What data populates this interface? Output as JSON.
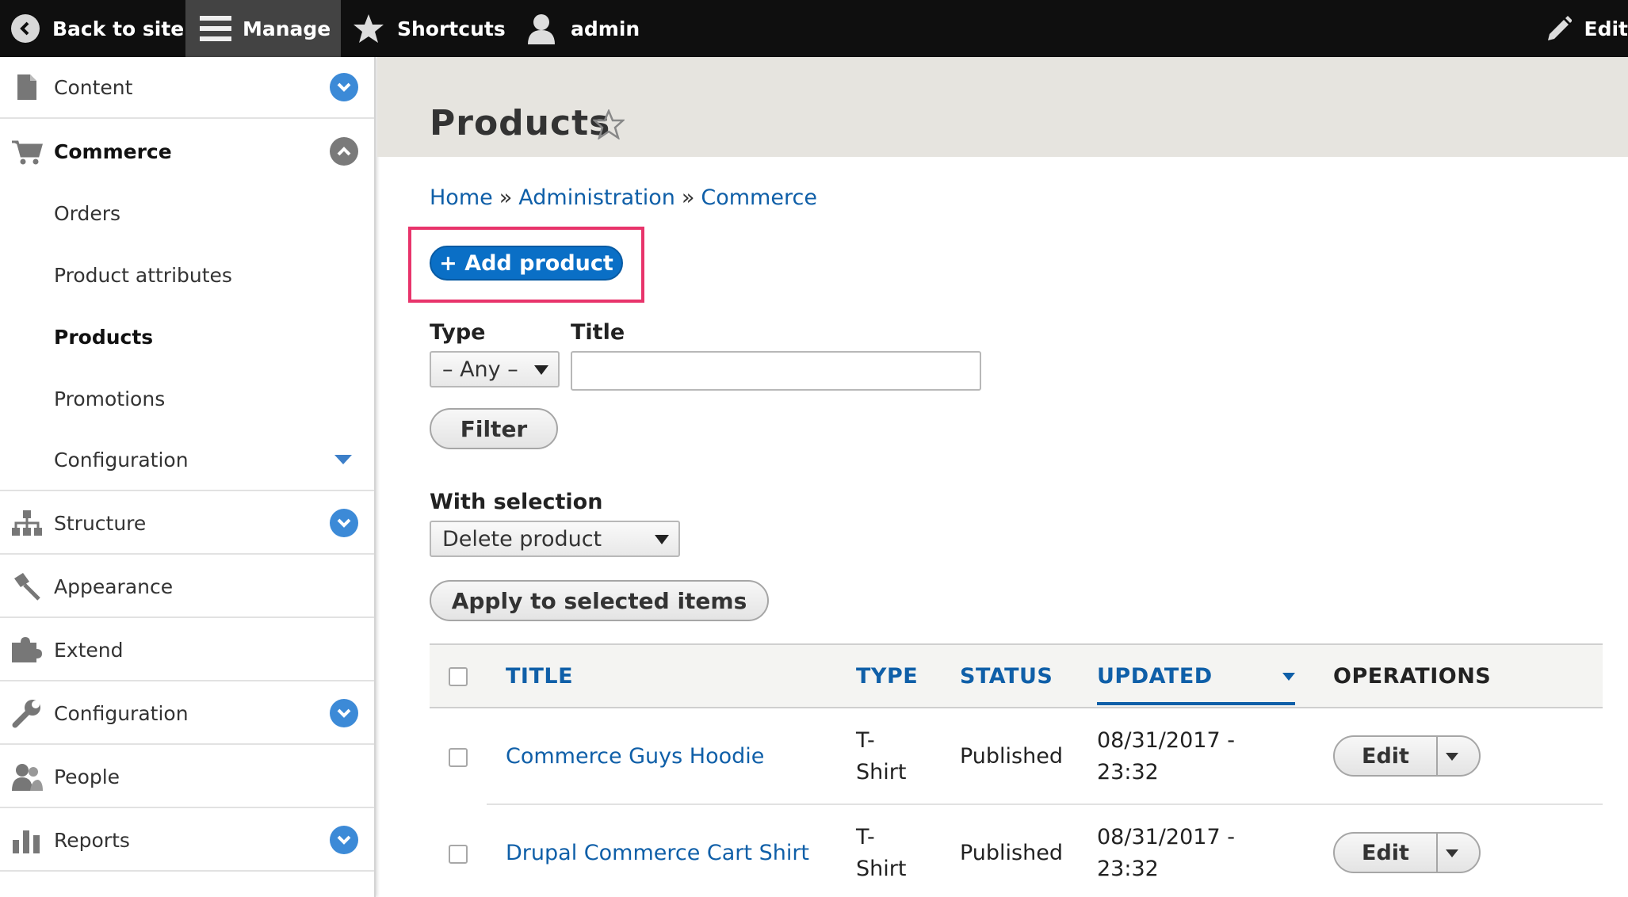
{
  "toolbar": {
    "back_label": "Back to site",
    "manage_label": "Manage",
    "shortcuts_label": "Shortcuts",
    "user_label": "admin",
    "edit_label": "Edit"
  },
  "sidebar": {
    "items": [
      {
        "label": "Content",
        "icon": "file-icon"
      },
      {
        "label": "Commerce",
        "icon": "cart-icon"
      },
      {
        "label": "Structure",
        "icon": "sitemap-icon"
      },
      {
        "label": "Appearance",
        "icon": "brush-icon"
      },
      {
        "label": "Extend",
        "icon": "puzzle-icon"
      },
      {
        "label": "Configuration",
        "icon": "wrench-icon"
      },
      {
        "label": "People",
        "icon": "people-icon"
      },
      {
        "label": "Reports",
        "icon": "bar-chart-icon"
      }
    ],
    "commerce_children": [
      {
        "label": "Orders"
      },
      {
        "label": "Product attributes"
      },
      {
        "label": "Products"
      },
      {
        "label": "Promotions"
      },
      {
        "label": "Configuration"
      }
    ]
  },
  "page": {
    "title": "Products",
    "breadcrumb": [
      "Home",
      "Administration",
      "Commerce"
    ],
    "breadcrumb_separator": "»",
    "add_button": "+ Add product"
  },
  "filters": {
    "type_label": "Type",
    "type_value": "– Any –",
    "title_label": "Title",
    "title_value": "",
    "filter_button": "Filter"
  },
  "bulk": {
    "label": "With selection",
    "action_value": "Delete product",
    "apply_button": "Apply to selected items"
  },
  "table": {
    "columns": [
      "TITLE",
      "TYPE",
      "STATUS",
      "UPDATED",
      "OPERATIONS"
    ],
    "rows": [
      {
        "title": "Commerce Guys Hoodie",
        "type_line1": "T-",
        "type_line2": "Shirt",
        "status": "Published",
        "updated_line1": "08/31/2017 -",
        "updated_line2": "23:32",
        "operation": "Edit"
      },
      {
        "title": "Drupal Commerce Cart Shirt",
        "type_line1": "T-",
        "type_line2": "Shirt",
        "status": "Published",
        "updated_line1": "08/31/2017 -",
        "updated_line2": "23:32",
        "operation": "Edit"
      }
    ]
  },
  "colors": {
    "toolbar_bg": "#0f0f0f",
    "accent_blue": "#0a6fc6",
    "link_blue": "#0f5fa8",
    "highlight": "#e8346b"
  }
}
